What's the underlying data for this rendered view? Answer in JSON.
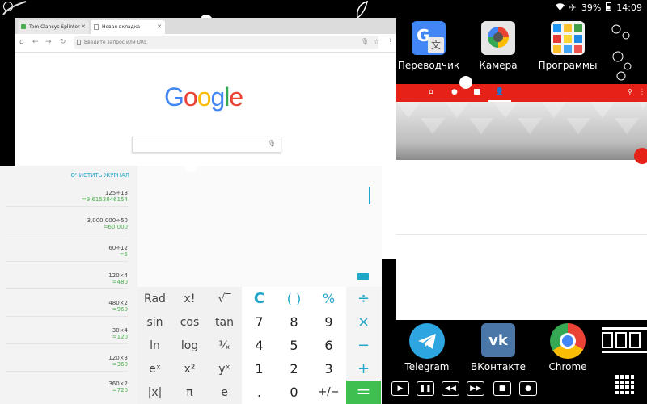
{
  "status_bar": {
    "battery": "39%",
    "time": "14:09",
    "icons": [
      "wifi-icon",
      "airplane-icon",
      "battery-icon"
    ]
  },
  "home_top_apps": [
    {
      "label": "Переводчик",
      "icon": "google-translate-icon"
    },
    {
      "label": "Камера",
      "icon": "camera-icon"
    },
    {
      "label": "Программы",
      "icon": "apps-folder-icon"
    }
  ],
  "chrome": {
    "tabs": [
      {
        "label": "Tom Clancys Splinter Cell",
        "active": false
      },
      {
        "label": "Новая вкладка",
        "active": true
      }
    ],
    "omnibox_placeholder": "Введите запрос или URL",
    "google_logo": "Google"
  },
  "calculator": {
    "clear_log": "ОЧИСТИТЬ ЖУРНАЛ",
    "history": [
      {
        "expr": "125÷13",
        "result": "=9.6153846154"
      },
      {
        "expr": "3,000,000÷50",
        "result": "=60,000"
      },
      {
        "expr": "60÷12",
        "result": "=5"
      },
      {
        "expr": "120×4",
        "result": "=480"
      },
      {
        "expr": "480×2",
        "result": "=960"
      },
      {
        "expr": "30×4",
        "result": "=120"
      },
      {
        "expr": "120×3",
        "result": "=360"
      },
      {
        "expr": "360×2",
        "result": "=720"
      }
    ],
    "sci_keys": [
      [
        "Rad",
        "x!",
        "√‾"
      ],
      [
        "sin",
        "cos",
        "tan"
      ],
      [
        "ln",
        "log",
        "¹⁄ₓ"
      ],
      [
        "eˣ",
        "x²",
        "yˣ"
      ],
      [
        "|x|",
        "π",
        "e"
      ]
    ],
    "num_keys": [
      [
        "C",
        "( )",
        "%",
        "÷"
      ],
      [
        "7",
        "8",
        "9",
        "×"
      ],
      [
        "4",
        "5",
        "6",
        "−"
      ],
      [
        "1",
        "2",
        "3",
        "+"
      ],
      [
        ".",
        "0",
        "+/−",
        "="
      ]
    ]
  },
  "dock": [
    {
      "label": "Telegram",
      "icon": "telegram-icon"
    },
    {
      "label": "ВКонтакте",
      "icon": "vk-icon"
    },
    {
      "label": "Chrome",
      "icon": "chrome-icon"
    }
  ],
  "colors": {
    "youtube_red": "#e62117",
    "calc_accent": "#1fa6c9",
    "equals_green": "#3fbf4f"
  }
}
